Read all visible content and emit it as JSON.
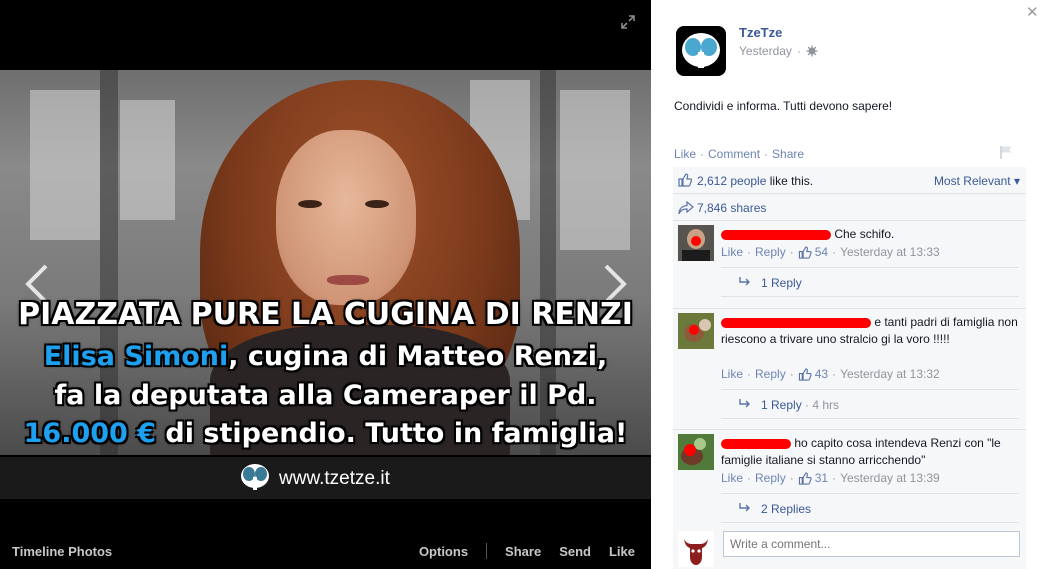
{
  "photo_viewer": {
    "overlay": {
      "line1": "PIAZZATA PURE LA CUGINA DI RENZI",
      "line2_name": "Elisa Simoni",
      "line2_rest": ", cugina di Matteo Renzi,",
      "line3": "fa la deputata alla Cameraper il Pd.",
      "line4_amount": "16.000 €",
      "line4_rest": " di stipendio. Tutto in famiglia!",
      "highlight_color": "#1ea0f0"
    },
    "banner_url": "www.tzetze.it",
    "footer": {
      "album": "Timeline Photos",
      "actions": [
        "Options",
        "Share",
        "Send",
        "Like"
      ]
    }
  },
  "post": {
    "page_name": "TzeTze",
    "time": "Yesterday",
    "text": "Condividi e informa. Tutti devono sapere!",
    "actions": [
      "Like",
      "Comment",
      "Share"
    ],
    "likes_count": "2,612 people",
    "likes_suffix": " like this.",
    "sort_label": "Most Relevant ▾",
    "shares": "7,846 shares",
    "compose_placeholder": "Write a comment..."
  },
  "comments": [
    {
      "text": "Che schifo.",
      "like_label": "Like",
      "reply_label": "Reply",
      "likes": "54",
      "time": "Yesterday at 13:33",
      "replies": "1 Reply",
      "replies_time": ""
    },
    {
      "text": "e tanti padri di famiglia non riescono a trivare uno stralcio gi la voro !!!!!",
      "like_label": "Like",
      "reply_label": "Reply",
      "likes": "43",
      "time": "Yesterday at 13:32",
      "replies": "1 Reply",
      "replies_time": "4 hrs"
    },
    {
      "text": "ho capito cosa intendeva Renzi con \"le famiglie italiane si stanno arricchendo\"",
      "like_label": "Like",
      "reply_label": "Reply",
      "likes": "31",
      "time": "Yesterday at 13:39",
      "replies": "2 Replies",
      "replies_time": ""
    }
  ],
  "colors": {
    "link": "#3b5998",
    "action_link": "#6d84b4",
    "muted": "#90949c",
    "redaction": "#ff0000"
  }
}
